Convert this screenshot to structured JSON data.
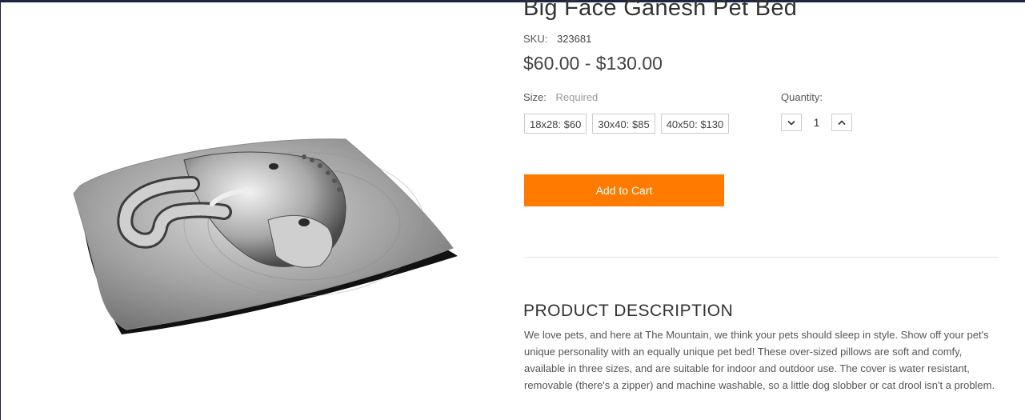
{
  "product": {
    "title": "Big Face Ganesh Pet Bed",
    "sku_label": "SKU:",
    "sku_value": "323681",
    "price": "$60.00 - $130.00",
    "image_alt": "Big Face Ganesh pet bed pillow with silver elephant artwork"
  },
  "options": {
    "size_label": "Size:",
    "size_required": "Required",
    "sizes": [
      {
        "label": "18x28: $60"
      },
      {
        "label": "30x40: $85"
      },
      {
        "label": "40x50: $130"
      }
    ]
  },
  "quantity": {
    "label": "Quantity:",
    "value": "1",
    "decrease_icon": "chevron-down-icon",
    "increase_icon": "chevron-up-icon"
  },
  "cart": {
    "add_label": "Add to Cart",
    "button_color": "#ff7a00"
  },
  "description": {
    "heading": "PRODUCT DESCRIPTION",
    "body": "We love pets, and here at The Mountain, we think your pets should sleep in style.  Show off your pet's unique personality with an equally unique pet bed!  These over-sized pillows are soft and comfy, available in three sizes, and are suitable for indoor and outdoor use.  The cover is water resistant, removable (there's a zipper) and machine washable, so a little dog slobber or cat drool isn't a problem."
  }
}
